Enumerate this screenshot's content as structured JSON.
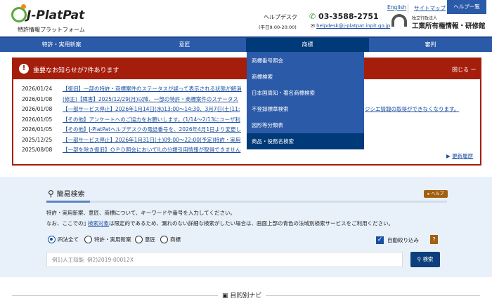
{
  "header": {
    "logo": "J-PlatPat",
    "subtitle": "特許情報プラットフォーム",
    "helpdesk": "ヘルプデスク",
    "hours": "(平日9:00-20:00)",
    "phone": "03-3588-2751",
    "email": "helpdesk@j-platpat.inpit.go.jp",
    "english": "English",
    "sitemap": "サイトマップ",
    "help_list": "ヘルプ一覧",
    "org_type": "独立行政法人",
    "org_name": "工業所有権情報・研修館"
  },
  "nav": [
    "特許・実用新案",
    "意匠",
    "商標",
    "審判"
  ],
  "dropdown": [
    "商標番号照会",
    "商標検索",
    "日本国周知・著名商標検索",
    "不登録標章検索",
    "図形等分類表",
    "商品・役務名検索"
  ],
  "notice": {
    "title": "重要なお知らせが7件あります",
    "close": "閉じる ー",
    "history": "更新履歴",
    "items": [
      {
        "date": "2026/01/24",
        "text": "【復旧】一部の特許・商標案件のステータスが誤って表示される状態が解消"
      },
      {
        "date": "2026/01/08",
        "text": "(修正)【障害】2025/12/29(月)以降、一部の特許・商標案件のステータス"
      },
      {
        "date": "2026/01/08",
        "text": "【一部サービス停止】2026年1月14日(水)13:00～14:30、3月7日(土)11:",
        "tail": "ジシエ情報の取得ができなくなります。"
      },
      {
        "date": "2026/01/05",
        "text": "【その他】アンケートへのご協力をお願いします。(1/14～2/13にユーザ利"
      },
      {
        "date": "2026/01/05",
        "text": "【その他】J-PlatPatヘルプデスクの電話番号を、2026年4月1日より変更し"
      },
      {
        "date": "2025/12/25",
        "text": "【一部サービス停止】2026年1月31日(土)09:00～22:00(予定)特許・実用"
      },
      {
        "date": "2025/08/08",
        "text": "【一部を除き復旧】ＯＰＤ照会においてILの分類引用情報が取得できません"
      }
    ]
  },
  "search": {
    "title": "簡易検索",
    "help": "▸ ヘルプ",
    "desc1": "特許・実用新案、意匠、商標について、キーワードや番号を入力してください。",
    "desc2_pre": "なお、ここでの",
    "desc2_link": "検索対象",
    "desc2_post": "は限定的であるため、漏れのない詳細な検索がしたい場合は、画面上部の青色の法域別検索サービスをご利用ください。",
    "options": [
      "四法全て",
      "特許・実用新案",
      "意匠",
      "商標"
    ],
    "selected": "四法全て",
    "auto_filter": "自動絞り込み",
    "auto_filter_checked": true,
    "placeholder": "例1)人工知能  例2)2019-00012X",
    "button": "検索"
  },
  "navi": "目的別ナビ"
}
